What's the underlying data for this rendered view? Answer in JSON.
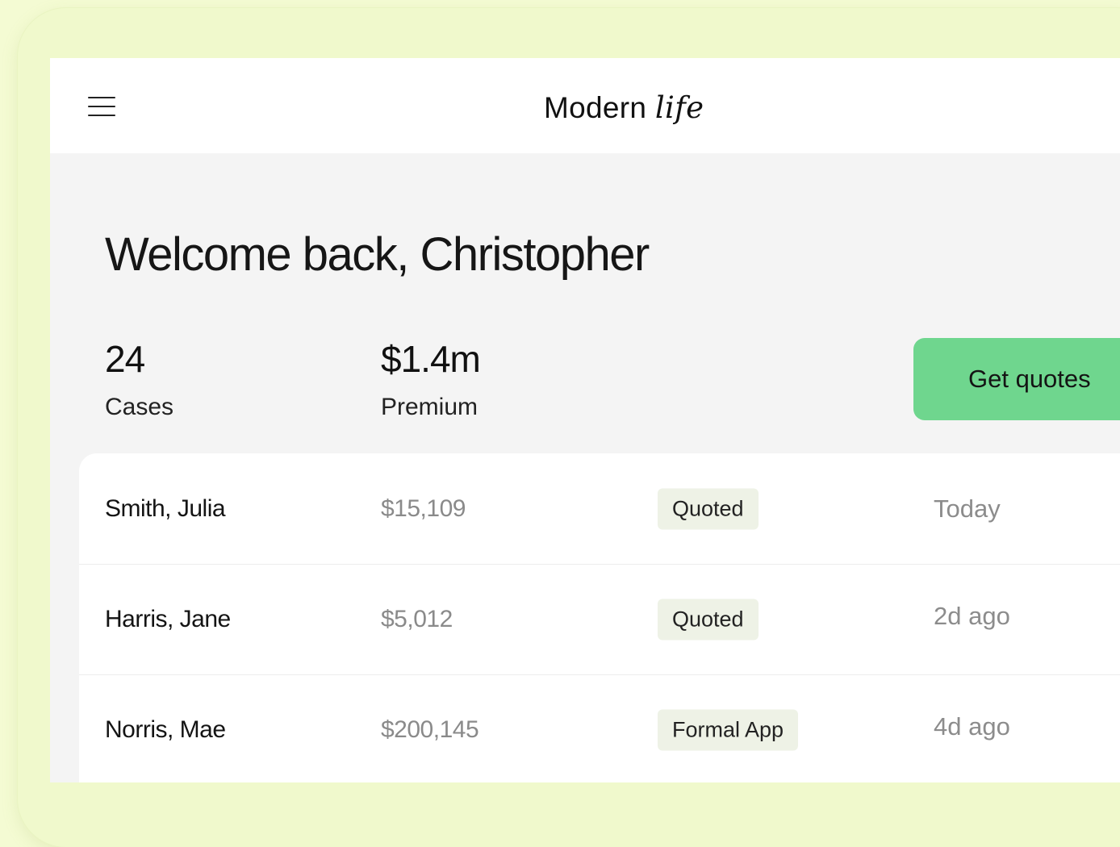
{
  "header": {
    "logo_text": "Modern ",
    "logo_script": "life"
  },
  "welcome": {
    "title": "Welcome back, Christopher"
  },
  "stats": [
    {
      "value": "24",
      "label": "Cases"
    },
    {
      "value": "$1.4m",
      "label": "Premium"
    }
  ],
  "actions": {
    "get_quotes_label": "Get quotes"
  },
  "cases": [
    {
      "name": "Smith, Julia",
      "amount": "$15,109",
      "status": "Quoted",
      "time": "Today"
    },
    {
      "name": "Harris, Jane",
      "amount": "$5,012",
      "status": "Quoted",
      "time": "2d ago"
    },
    {
      "name": "Norris, Mae",
      "amount": "$200,145",
      "status": "Formal App",
      "time": "4d ago"
    }
  ],
  "colors": {
    "background": "#f4fbd3",
    "accent_button": "#6fd68e",
    "status_badge": "#eef2e6"
  },
  "icons": {
    "menu": "hamburger-menu-icon"
  }
}
